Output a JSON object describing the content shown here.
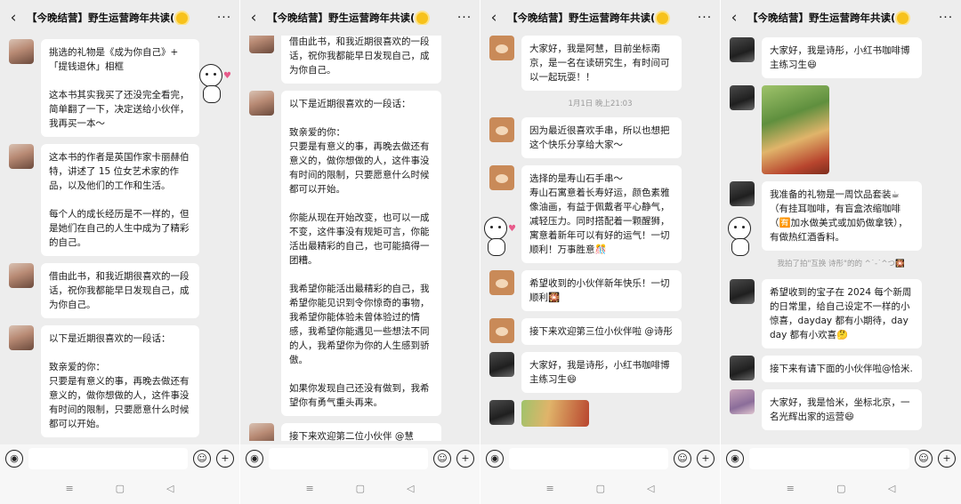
{
  "header": {
    "back_glyph": "‹",
    "title": "【今晚结营】野生运营跨年共读(",
    "more_glyph": "···",
    "sun_icon": "sun-emoji"
  },
  "input_bar": {
    "voice_glyph": "◉",
    "emoji_glyph": "☺",
    "plus_glyph": "+"
  },
  "nav_bar": {
    "menu_glyph": "≡",
    "home_glyph": "▢",
    "back_glyph": "◁"
  },
  "panels": [
    {
      "messages": [
        {
          "avatar": "av-girl",
          "text": "挑选的礼物是《成为你自己》+「提钱退休」相框\n\n这本书其实我买了还没完全看完，简单翻了一下，决定送给小伙伴，我再买一本～"
        },
        {
          "avatar": "av-girl",
          "text": "这本书的作者是英国作家卡丽赫伯特，讲述了 15 位女艺术家的作品，以及他们的工作和生活。\n\n每个人的成长经历是不一样的，但是她们在自己的人生中成为了精彩的自己。"
        },
        {
          "avatar": "av-girl",
          "text": "借由此书，和我近期很喜欢的一段话，祝你我都能早日发现自己，成为你自己。"
        },
        {
          "avatar": "av-girl",
          "text": "以下是近期很喜欢的一段话：\n\n致亲爱的你：\n只要是有意义的事，再晚去做还有意义的，做你想做的人，这件事没有时间的限制，只要愿意什么时候都可以开始。"
        }
      ]
    },
    {
      "messages": [
        {
          "avatar": "av-girl",
          "text": "借由此书，和我近期很喜欢的一段话，祝你我都能早日发现自己，成为你自己。"
        },
        {
          "avatar": "av-girl",
          "text": "以下是近期很喜欢的一段话：\n\n致亲爱的你：\n只要是有意义的事，再晚去做还有意义的，做你想做的人，这件事没有时间的限制，只要愿意什么时候都可以开始。\n\n你能从现在开始改变，也可以一成不变，这件事没有规矩可言，你能活出最精彩的自己，也可能搞得一团糟。\n\n我希望你能活出最精彩的自己，我希望你能见识到令你惊奇的事物，我希望你能体验未曾体验过的情感，我希望你能遇见一些想法不同的人，我希望你为你的人生感到骄傲。\n\n如果你发现自己还没有做到，我希望你有勇气重头再来。"
        },
        {
          "avatar": "av-girl",
          "text": "接下来欢迎第二位小伙伴 @慧"
        }
      ]
    },
    {
      "messages": [
        {
          "avatar": "av-bear",
          "text": "大家好，我是阿慧，目前坐标南京，是一名在读研究生，有时间可以一起玩耍！！"
        },
        {
          "kind": "time",
          "text": "1月1日 晚上21:03"
        },
        {
          "avatar": "av-bear",
          "text": "因为最近很喜欢手串，所以也想把这个快乐分享给大家～"
        },
        {
          "avatar": "av-bear",
          "text": "选择的是寿山石手串～\n寿山石寓意着长寿好运，颜色素雅像油画，有益于佩戴者平心静气，减轻压力。同时搭配着一颗醒狮，寓意着新年可以有好的运气！一切顺利！万事胜意🎊"
        },
        {
          "avatar": "av-bear",
          "text": "希望收到的小伙伴新年快乐！一切顺利🎇"
        },
        {
          "avatar": "av-bear",
          "text": "接下来欢迎第三位小伙伴啦 @诗彤"
        },
        {
          "avatar": "av-dark",
          "text": "大家好，我是诗彤，小红书咖啡博主练习生😄"
        },
        {
          "avatar": "av-dark",
          "kind": "photo2"
        }
      ]
    },
    {
      "messages": [
        {
          "avatar": "av-dark",
          "text": "大家好，我是诗彤，小红书咖啡博主练习生😄"
        },
        {
          "avatar": "av-dark",
          "kind": "photo"
        },
        {
          "avatar": "av-dark",
          "text": "我准备的礼物是一周饮品套装☕\n（有挂耳咖啡，有盲盒浓缩咖啡（🈶加水做美式或加奶做拿铁），有做热红酒香料。"
        },
        {
          "kind": "sys",
          "text": "我拍了拍\"互换 诗彤\"的的 ^˙-˙^つ🎇"
        },
        {
          "avatar": "av-dark",
          "text": "希望收到的宝子在 2024 每个新周的日常里，给自己设定不一样的小惊喜，dayday 都有小期待，dayday 都有小欢喜🤔"
        },
        {
          "avatar": "av-dark",
          "text": "接下来有请下面的小伙伴啦@恰米."
        },
        {
          "avatar": "av-city",
          "text": "大家好，我是恰米，坐标北京，一名光辉出家的运营😄"
        }
      ]
    }
  ]
}
